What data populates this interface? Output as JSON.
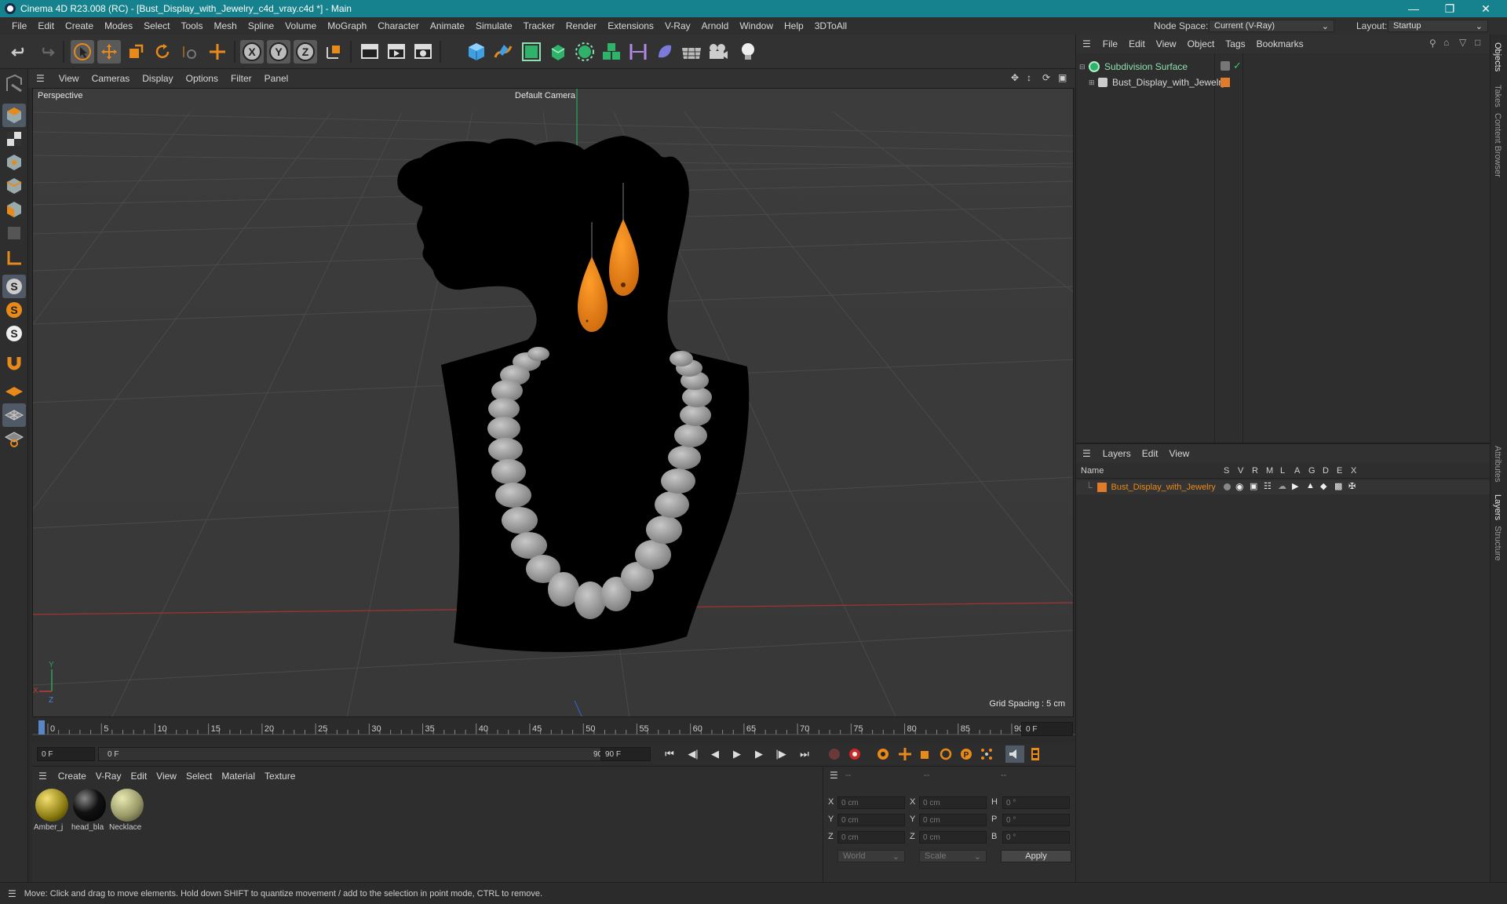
{
  "window": {
    "title": "Cinema 4D R23.008 (RC) - [Bust_Display_with_Jewelry_c4d_vray.c4d *] - Main"
  },
  "menubar": {
    "items": [
      "File",
      "Edit",
      "Create",
      "Modes",
      "Select",
      "Tools",
      "Mesh",
      "Spline",
      "Volume",
      "MoGraph",
      "Character",
      "Animate",
      "Simulate",
      "Tracker",
      "Render",
      "Extensions",
      "V-Ray",
      "Arnold",
      "Window",
      "Help",
      "3DToAll"
    ],
    "node_space_label": "Node Space:",
    "node_space_value": "Current (V-Ray)",
    "layout_label": "Layout:",
    "layout_value": "Startup"
  },
  "viewport": {
    "menu": [
      "View",
      "Cameras",
      "Display",
      "Options",
      "Filter",
      "Panel"
    ],
    "view_name": "Perspective",
    "camera": "Default Camera",
    "grid_spacing": "Grid Spacing : 5 cm"
  },
  "timeline": {
    "ticks": [
      "0",
      "5",
      "10",
      "15",
      "20",
      "25",
      "30",
      "35",
      "40",
      "45",
      "50",
      "55",
      "60",
      "65",
      "70",
      "75",
      "80",
      "85",
      "90"
    ],
    "current_frame": "0 F",
    "start_field": "0 F",
    "range_start": "0 F",
    "range_end": "90 F",
    "end_field": "90 F"
  },
  "materials": {
    "menu": [
      "Create",
      "V-Ray",
      "Edit",
      "View",
      "Select",
      "Material",
      "Texture"
    ],
    "items": [
      {
        "name": "Amber_j",
        "color": "#8a7a10"
      },
      {
        "name": "head_bla",
        "color": "#111111"
      },
      {
        "name": "Necklace",
        "color": "#9a9a6a"
      }
    ]
  },
  "coordinates": {
    "headers": [
      "--",
      "--",
      "--"
    ],
    "rows": [
      {
        "a": "X",
        "a_val": "0 cm",
        "b": "X",
        "b_val": "0 cm",
        "c": "H",
        "c_val": "0 °"
      },
      {
        "a": "Y",
        "a_val": "0 cm",
        "b": "Y",
        "b_val": "0 cm",
        "c": "P",
        "c_val": "0 °"
      },
      {
        "a": "Z",
        "a_val": "0 cm",
        "b": "Z",
        "b_val": "0 cm",
        "c": "B",
        "c_val": "0 °"
      }
    ],
    "space": "World",
    "mode": "Scale",
    "apply": "Apply"
  },
  "objects": {
    "menu": [
      "File",
      "Edit",
      "View",
      "Object",
      "Tags",
      "Bookmarks"
    ],
    "items": [
      {
        "name": "Subdivision Surface"
      },
      {
        "name": "Bust_Display_with_Jewelry"
      }
    ]
  },
  "layers": {
    "menu": [
      "Layers",
      "Edit",
      "View"
    ],
    "name_header": "Name",
    "columns": [
      "S",
      "V",
      "R",
      "M",
      "L",
      "A",
      "G",
      "D",
      "E",
      "X"
    ],
    "items": [
      {
        "name": "Bust_Display_with_Jewelry",
        "color": "#e07b2a"
      }
    ]
  },
  "side_tabs": [
    "Objects",
    "Takes",
    "Content Browser",
    "Attributes",
    "Layers",
    "Structure"
  ],
  "status": "Move: Click and drag to move elements. Hold down SHIFT to quantize movement / add to the selection in point mode, CTRL to remove.",
  "colors": {
    "accent": "#15828d",
    "orange": "#e88a1a",
    "selected": "#4f5a66"
  }
}
